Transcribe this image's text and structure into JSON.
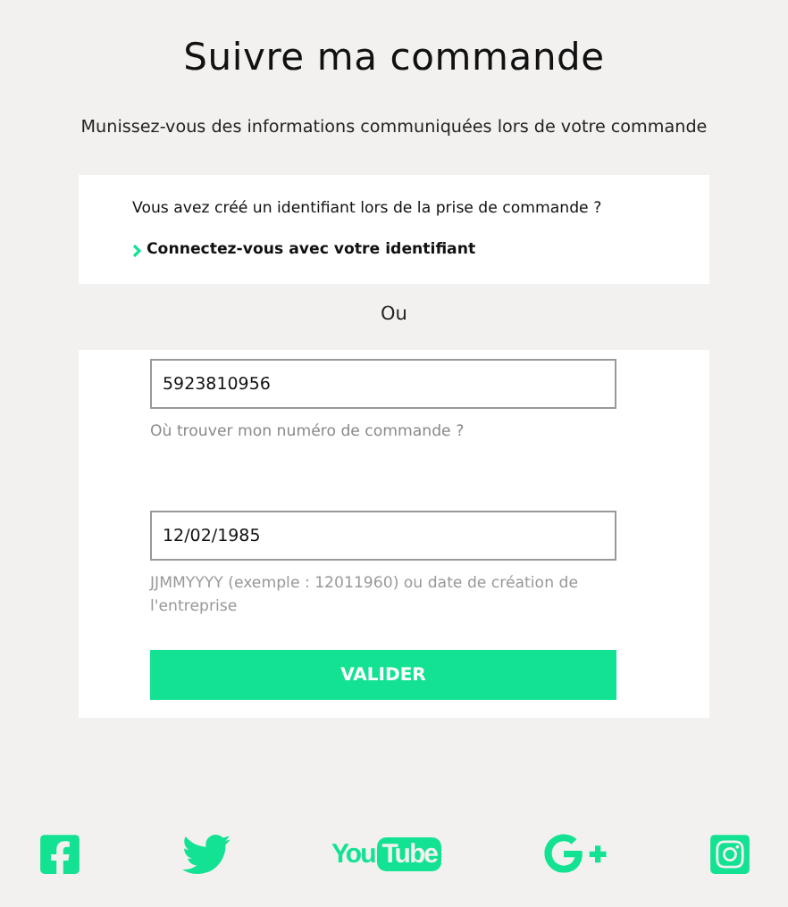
{
  "title": "Suivre ma commande",
  "subtitle": "Munissez-vous des informations communiquées lors de votre commande",
  "login_card": {
    "question": "Vous avez créé un identifiant lors de la prise de commande ?",
    "link": "Connectez-vous avec votre identifiant"
  },
  "separator": "Ou",
  "order_form": {
    "fields": [
      {
        "value": "5923810956",
        "help": "Où trouver mon numéro de commande ?",
        "kind": "link"
      },
      {
        "value": "12/02/1985",
        "help": "JJMMYYYY (exemple : 12011960) ou date de création de l'entreprise",
        "kind": "hint"
      }
    ],
    "submit": "VALIDER"
  },
  "social": [
    {
      "kind": "facebook"
    },
    {
      "kind": "twitter"
    },
    {
      "kind": "youtube",
      "logo_text": "You",
      "logo_box_text": "Tube"
    },
    {
      "kind": "googleplus"
    },
    {
      "kind": "instagram"
    }
  ]
}
